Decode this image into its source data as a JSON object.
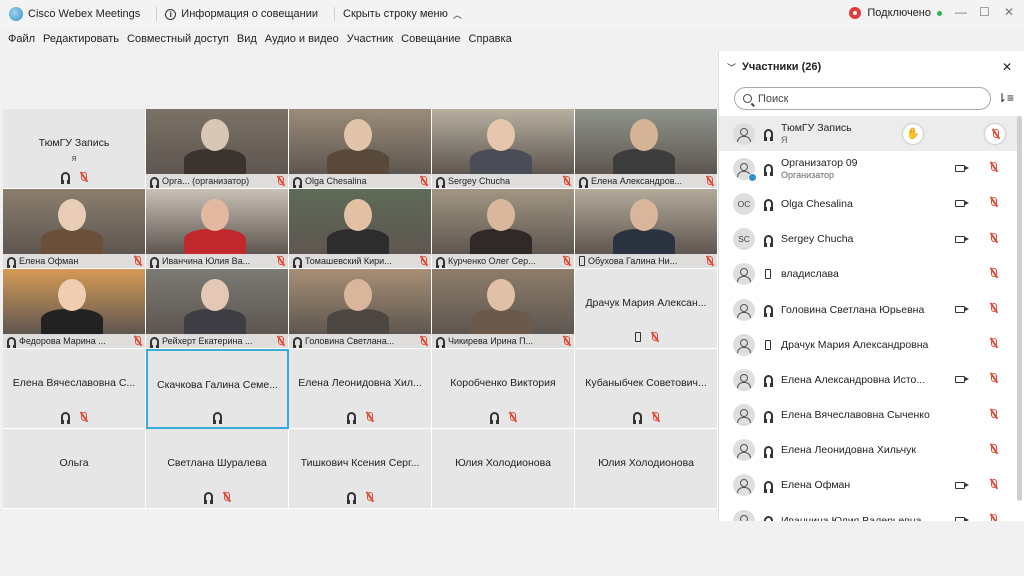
{
  "titlebar": {
    "app_title": "Cisco Webex Meetings",
    "meeting_info": "Информация о совещании",
    "hide_menu": "Скрыть строку меню",
    "status": "Подключено"
  },
  "menu": [
    "Файл",
    "Редактировать",
    "Совместный доступ",
    "Вид",
    "Аудио и видео",
    "Участник",
    "Совещание",
    "Справка"
  ],
  "grid": [
    {
      "name": "ТюмГУ Запись",
      "sub": "я",
      "type": "avatar",
      "icons": [
        "headset",
        "mute"
      ]
    },
    {
      "name": "Орга...",
      "extra": "(организатор)",
      "type": "video",
      "icons": [
        "headset",
        "mute"
      ]
    },
    {
      "name": "Olga Chesalina",
      "type": "video",
      "icons": [
        "headset",
        "mute"
      ]
    },
    {
      "name": "Sergey Chucha",
      "type": "video",
      "icons": [
        "headset",
        "mute"
      ]
    },
    {
      "name": "Елена Александров...",
      "type": "video",
      "icons": [
        "headset",
        "mute"
      ]
    },
    {
      "name": "Елена Офман",
      "type": "video",
      "icons": [
        "headset",
        "mute"
      ]
    },
    {
      "name": "Иванчина Юлия Ва...",
      "type": "video",
      "icons": [
        "headset",
        "mute"
      ]
    },
    {
      "name": "Томашевский Кири...",
      "type": "video",
      "icons": [
        "headset",
        "mute"
      ]
    },
    {
      "name": "Курченко Олег Сер...",
      "type": "video",
      "icons": [
        "headset",
        "mute"
      ]
    },
    {
      "name": "Обухова Галина Ни...",
      "type": "video",
      "icons": [
        "phone",
        "mute"
      ]
    },
    {
      "name": "Федорова Марина ...",
      "type": "video",
      "icons": [
        "headset",
        "mute"
      ]
    },
    {
      "name": "Рейхерт Екатерина ...",
      "type": "video",
      "icons": [
        "headset",
        "mute"
      ]
    },
    {
      "name": "Головина Светлана...",
      "type": "video",
      "icons": [
        "headset",
        "mute"
      ]
    },
    {
      "name": "Чикирева Ирина П...",
      "type": "video",
      "icons": [
        "headset",
        "mute"
      ]
    },
    {
      "name": "Драчук Мария Алексан...",
      "type": "avatar",
      "icons": [
        "phone",
        "mute"
      ]
    },
    {
      "name": "Елена Вячеславовна С...",
      "type": "avatar",
      "icons": [
        "headset",
        "mute"
      ]
    },
    {
      "name": "Скачкова Галина Семе...",
      "type": "avatar",
      "icons": [
        "headset"
      ],
      "selected": true
    },
    {
      "name": "Елена Леонидовна Хил...",
      "type": "avatar",
      "icons": [
        "headset",
        "mute"
      ]
    },
    {
      "name": "Коробченко Виктория",
      "type": "avatar",
      "icons": [
        "headset",
        "mute"
      ]
    },
    {
      "name": "Кубаныбчек Советович...",
      "type": "avatar",
      "icons": [
        "headset",
        "mute"
      ]
    },
    {
      "name": "Ольга",
      "type": "avatar",
      "icons": []
    },
    {
      "name": "Светлана Шуралева",
      "type": "avatar",
      "icons": [
        "headset",
        "mute"
      ]
    },
    {
      "name": "Тишкович Ксения Серг...",
      "type": "avatar",
      "icons": [
        "headset",
        "mute"
      ]
    },
    {
      "name": "Юлия Холодионова",
      "type": "avatar",
      "icons": []
    },
    {
      "name": "Юлия Холодионова",
      "type": "avatar",
      "icons": []
    }
  ],
  "panel": {
    "title": "Участники (26)",
    "search_placeholder": "Поиск",
    "participants": [
      {
        "name": "ТюмГУ Запись",
        "role": "Я",
        "initials": "",
        "audio": "headset",
        "hand": true,
        "highlight": true
      },
      {
        "name": "Организатор 09",
        "role": "Организатор",
        "initials": "",
        "audio": "headset",
        "cam": true,
        "webex": true
      },
      {
        "name": "Olga Chesalina",
        "initials": "OC",
        "audio": "headset",
        "cam": true
      },
      {
        "name": "Sergey Chucha",
        "initials": "SC",
        "audio": "headset",
        "cam": true
      },
      {
        "name": "владислава",
        "initials": "",
        "audio": "phone"
      },
      {
        "name": "Головина Светлана Юрьевна",
        "initials": "",
        "audio": "headset",
        "cam": true
      },
      {
        "name": "Драчук Мария Александровна",
        "initials": "",
        "audio": "phone"
      },
      {
        "name": "Елена Александровна Исто...",
        "initials": "",
        "audio": "headset",
        "cam": true
      },
      {
        "name": "Елена Вячеславовна Сыченко",
        "initials": "",
        "audio": "headset"
      },
      {
        "name": "Елена Леонидовна Хильчук",
        "initials": "",
        "audio": "headset"
      },
      {
        "name": "Елена Офман",
        "initials": "",
        "audio": "headset",
        "cam": true
      },
      {
        "name": "Иванчина Юлия Валерьевна",
        "initials": "",
        "audio": "headset",
        "cam": true
      }
    ]
  },
  "colors": {
    "accent": "#3aaad8",
    "mute": "#e34a3a",
    "connected": "#2db34a",
    "record": "#e23b3b"
  }
}
